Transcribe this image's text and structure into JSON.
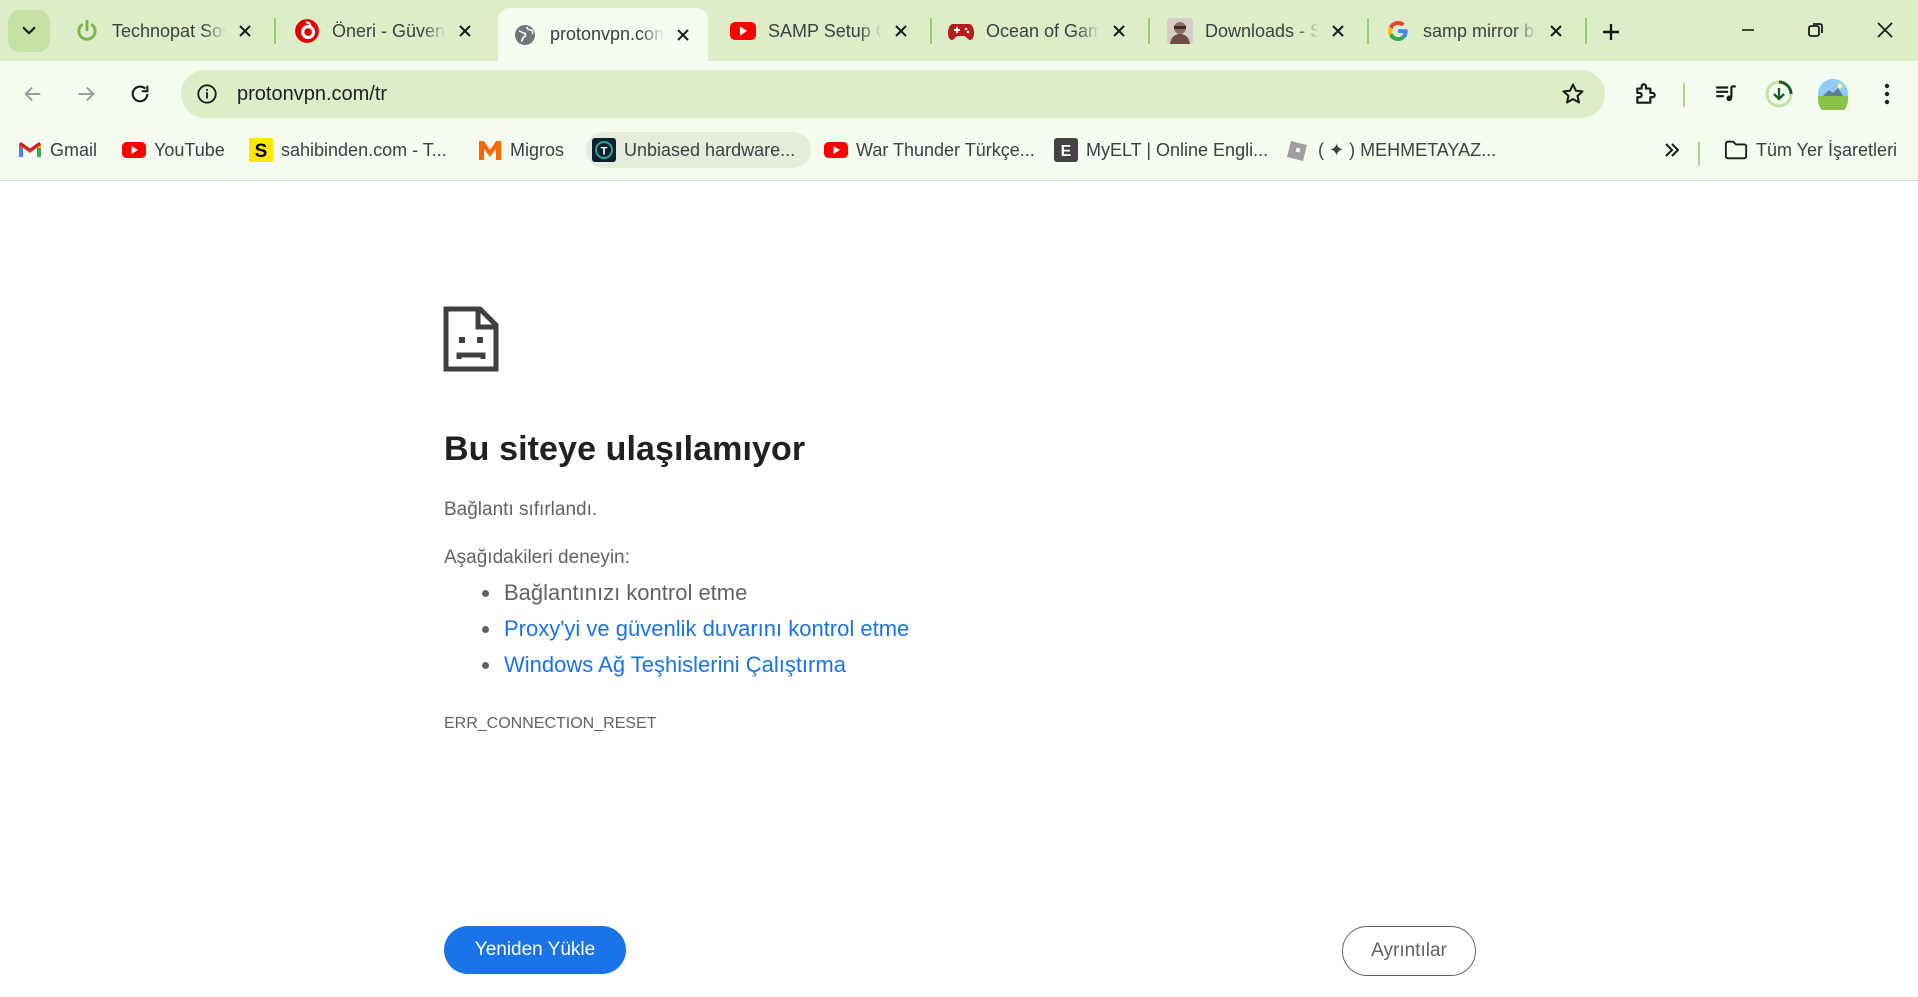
{
  "tabs": [
    {
      "title": "Technopat Sosyal",
      "icon": "power-icon",
      "color": "#7cb342"
    },
    {
      "title": "Öneri - Güvenli",
      "icon": "vodafone-icon",
      "color": "#e60000"
    },
    {
      "title": "protonvpn.com/tr",
      "icon": "globe-icon",
      "color": "#5f6368",
      "active": true
    },
    {
      "title": "SAMP Setup Guide",
      "icon": "youtube-icon",
      "color": "#ff0000"
    },
    {
      "title": "Ocean of Games",
      "icon": "gamepad-icon",
      "color": "#b71c1c"
    },
    {
      "title": "Downloads - SA-MP",
      "icon": "avatar-icon",
      "color": "#8d6e63"
    },
    {
      "title": "samp mirror başka",
      "icon": "google-icon",
      "color": "#4285f4"
    }
  ],
  "toolbar": {
    "url": "protonvpn.com/tr"
  },
  "bookmarks": [
    {
      "label": "Gmail",
      "icon": "gmail-icon"
    },
    {
      "label": "YouTube",
      "icon": "youtube-icon"
    },
    {
      "label": "sahibinden.com - T...",
      "icon": "sahibinden-icon"
    },
    {
      "label": "Migros",
      "icon": "migros-icon"
    },
    {
      "label": "Unbiased hardware...",
      "icon": "techpowerup-icon"
    },
    {
      "label": "War Thunder Türkçe...",
      "icon": "youtube-icon"
    },
    {
      "label": "MyELT | Online Engli...",
      "icon": "myelt-icon"
    },
    {
      "label": "( ✦ ) MEHMETAYAZ...",
      "icon": "roblox-icon"
    }
  ],
  "bookmarks_all": "Tüm Yer İşaretleri",
  "error": {
    "title": "Bu siteye ulaşılamıyor",
    "description": "Bağlantı sıfırlandı.",
    "try_label": "Aşağıdakileri deneyin:",
    "suggestions": [
      {
        "text": "Bağlantınızı kontrol etme",
        "link": false
      },
      {
        "text": "Proxy'yi ve güvenlik duvarını kontrol etme",
        "link": true
      },
      {
        "text": "Windows Ağ Teşhislerini Çalıştırma",
        "link": true
      }
    ],
    "code": "ERR_CONNECTION_RESET",
    "reload_label": "Yeniden Yükle",
    "details_label": "Ayrıntılar"
  }
}
